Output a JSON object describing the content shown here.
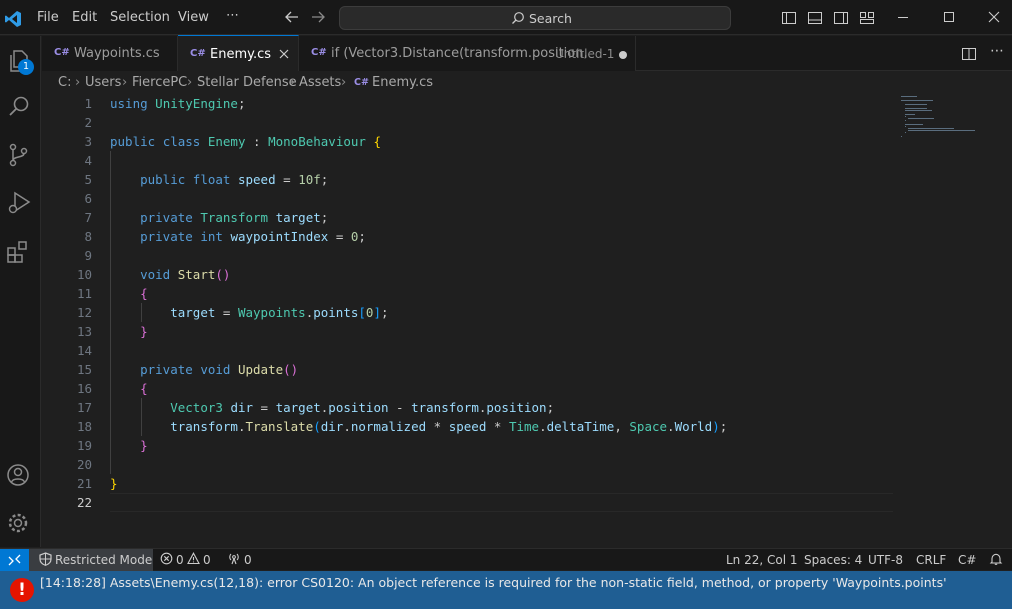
{
  "menu": [
    "File",
    "Edit",
    "Selection",
    "View",
    "⋯"
  ],
  "search": {
    "label": "Search"
  },
  "activity_bar": {
    "items": [
      "explorer-icon",
      "search-icon",
      "source-control-icon",
      "run-debug-icon",
      "extensions-icon"
    ],
    "explorer_badge": "1",
    "bottom_items": [
      "accounts-icon",
      "settings-gear-icon"
    ]
  },
  "tabs": [
    {
      "label": "Waypoints.cs",
      "icon": "C#"
    },
    {
      "label": "Enemy.cs",
      "icon": "C#",
      "active": true
    },
    {
      "label": "if (Vector3.Distance(transform.position,",
      "subtitle": "Untitled-1",
      "icon": "C#",
      "dirty": true
    }
  ],
  "breadcrumb": {
    "parts": [
      "C:",
      "Users",
      "FiercePC",
      "Stellar Defense",
      "Assets"
    ],
    "file_icon": "C#",
    "file": "Enemy.cs"
  },
  "editor": {
    "current_line": 22,
    "line_numbers": [
      "1",
      "2",
      "3",
      "4",
      "5",
      "6",
      "7",
      "8",
      "9",
      "10",
      "11",
      "12",
      "13",
      "14",
      "15",
      "16",
      "17",
      "18",
      "19",
      "20",
      "21",
      "22"
    ],
    "lines": [
      "using UnityEngine;",
      "",
      "public class Enemy : MonoBehaviour {",
      "",
      "    public float speed = 10f;",
      "",
      "    private Transform target;",
      "    private int waypointIndex = 0;",
      "",
      "    void Start()",
      "    {",
      "        target = Waypoints.points[0];",
      "    }",
      "",
      "    private void Update()",
      "    {",
      "        Vector3 dir = target.position - transform.position;",
      "        transform.Translate(dir.normalized * speed * Time.deltaTime, Space.World);",
      "    }",
      "",
      "}",
      ""
    ]
  },
  "statusbar": {
    "restricted_mode": "Restricted Mode",
    "errors": "0",
    "warnings": "0",
    "ports": "0",
    "cursor": "Ln 22, Col 1",
    "indent": "Spaces: 4",
    "encoding": "UTF-8",
    "eol": "CRLF",
    "language": "C#"
  },
  "error_panel": {
    "icon": "!",
    "message": "[14:18:28] Assets\\Enemy.cs(12,18): error CS0120: An object reference is required for the non-static field, method, or property 'Waypoints.points'"
  },
  "colors": {
    "accent": "#0078d4",
    "error_panel_bg": "#1f5e93",
    "error_icon": "#e51400"
  }
}
